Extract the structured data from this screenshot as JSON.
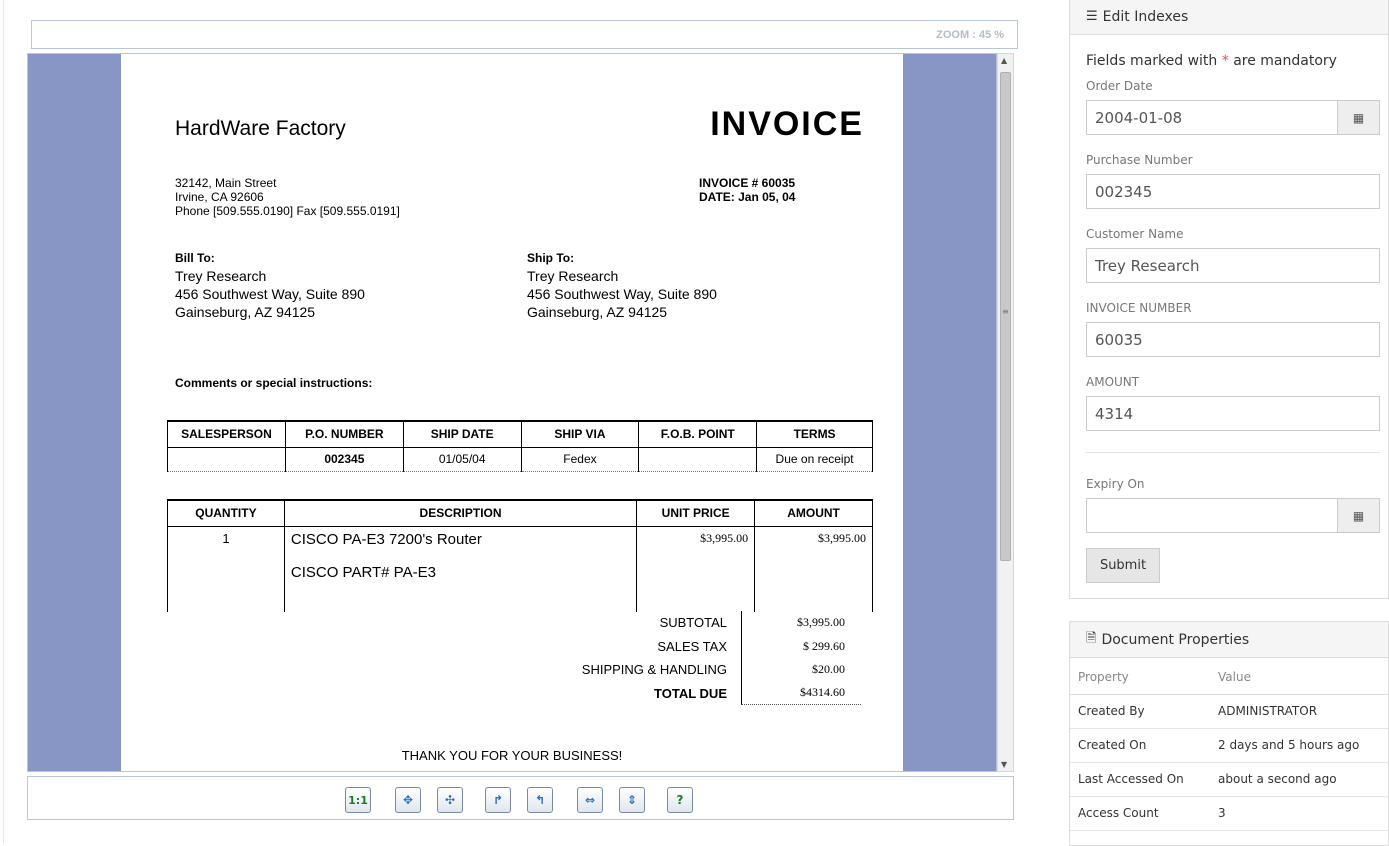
{
  "viewer": {
    "zoom_label": "ZOOM : 45 %"
  },
  "invoice": {
    "company": "HardWare Factory",
    "title": "INVOICE",
    "address_line1": "32142, Main Street",
    "address_line2": "Irvine, CA 92606",
    "phone_line": "Phone [509.555.0190]  Fax [509.555.0191]",
    "invoice_no": "INVOICE # 60035",
    "date": "DATE: Jan  05, 04",
    "bill_to_title": "Bill To:",
    "bill_to": [
      "Trey Research",
      "456 Southwest Way, Suite 890",
      "Gainseburg, AZ 94125"
    ],
    "ship_to_title": "Ship To:",
    "ship_to": [
      "Trey Research",
      "456 Southwest Way, Suite 890",
      "Gainseburg, AZ 94125"
    ],
    "comments": "Comments or special instructions:",
    "ship_table": {
      "headers": [
        "SALESPERSON",
        "P.O. NUMBER",
        "SHIP DATE",
        "SHIP VIA",
        "F.O.B. POINT",
        "TERMS"
      ],
      "row": [
        "",
        "002345",
        "01/05/04",
        "Fedex",
        "",
        "Due on receipt"
      ]
    },
    "items_table": {
      "headers": [
        "QUANTITY",
        "DESCRIPTION",
        "UNIT PRICE",
        "AMOUNT"
      ],
      "row": {
        "quantity": "1",
        "desc1": "CISCO PA-E3 7200's Router",
        "desc2": "CISCO PART# PA-E3",
        "unit_price": "$3,995.00",
        "amount": "$3,995.00"
      }
    },
    "totals": {
      "subtotal_label": "SUBTOTAL",
      "subtotal": "$3,995.00",
      "tax_label": "SALES TAX",
      "tax": "$ 299.60",
      "shipping_label": "SHIPPING & HANDLING",
      "shipping": "$20.00",
      "total_label": "TOTAL DUE",
      "total": "$4314.60"
    },
    "thanks": "THANK YOU FOR YOUR BUSINESS!"
  },
  "toolbar": {
    "actual_size": "1:1",
    "help": "?"
  },
  "edit_panel": {
    "title": "Edit Indexes",
    "mandatory_prefix": "Fields marked with ",
    "mandatory_star": "*",
    "mandatory_suffix": " are mandatory",
    "order_date_label": "Order Date",
    "order_date": "2004-01-08",
    "purchase_number_label": "Purchase Number",
    "purchase_number": "002345",
    "customer_name_label": "Customer Name",
    "customer_name": "Trey Research",
    "invoice_number_label": "INVOICE NUMBER",
    "invoice_number": "60035",
    "amount_label": "AMOUNT",
    "amount": "4314",
    "expiry_label": "Expiry On",
    "expiry": "",
    "submit": "Submit"
  },
  "props_panel": {
    "title": "Document Properties",
    "col_property": "Property",
    "col_value": "Value",
    "rows": [
      {
        "property": "Created By",
        "value": "ADMINISTRATOR"
      },
      {
        "property": "Created On",
        "value": "2 days and 5 hours ago"
      },
      {
        "property": "Last Accessed On",
        "value": "about a second ago"
      },
      {
        "property": "Access Count",
        "value": "3"
      }
    ]
  },
  "colors": {
    "viewer_background": "#8896c5",
    "mandatory_star": "#d9534f",
    "toolbar_icon_green": "#1f7a26",
    "toolbar_icon_blue": "#2a6fc4"
  },
  "icons": [
    "list-icon",
    "calendar-icon",
    "document-icon",
    "fit-page-icon",
    "fit-width-icon",
    "rotate-right-icon",
    "rotate-left-icon",
    "fit-horizontal-icon",
    "fit-vertical-icon",
    "help-icon"
  ]
}
